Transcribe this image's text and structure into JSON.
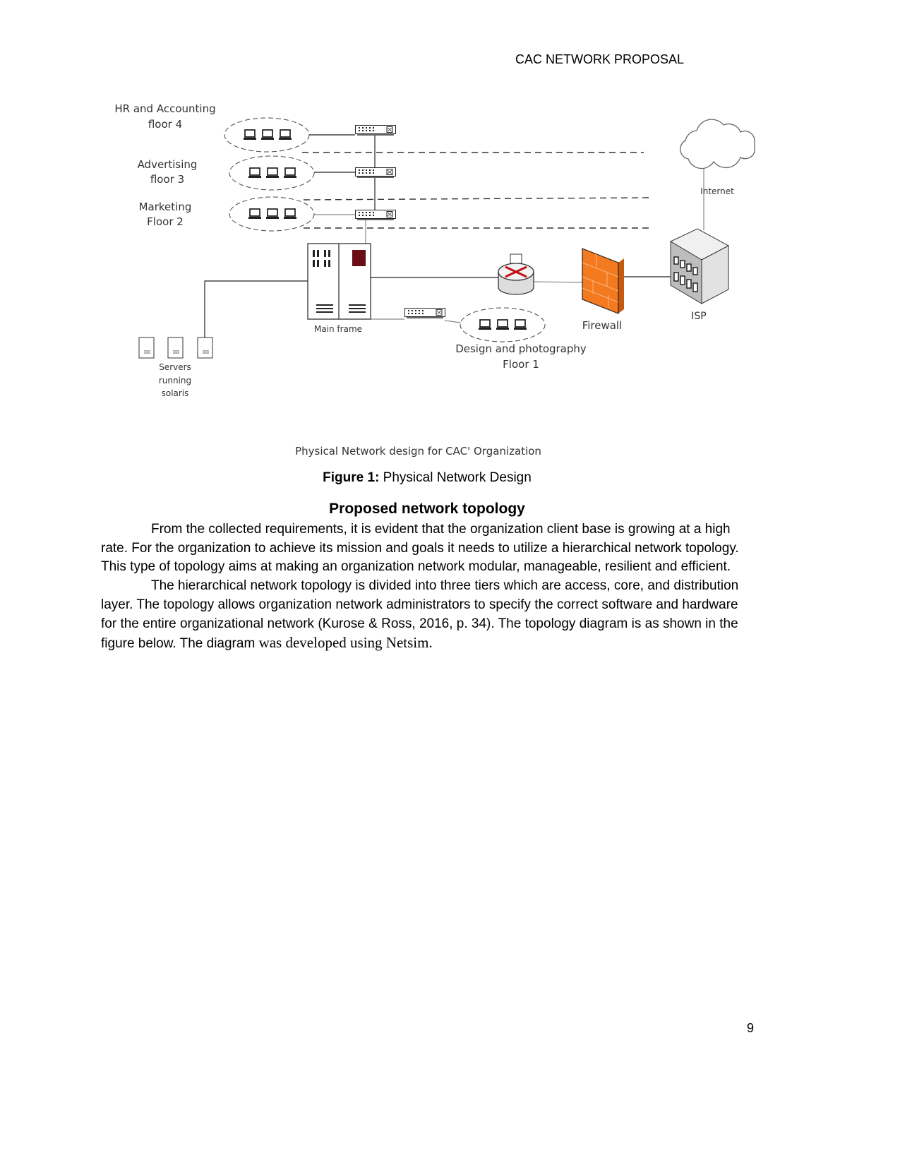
{
  "header": {
    "running_head": "CAC NETWORK PROPOSAL"
  },
  "diagram": {
    "labels": {
      "hr_line1": "HR and Accounting",
      "hr_line2": "floor 4",
      "adv_line1": "Advertising",
      "adv_line2": "floor 3",
      "mkt_line1": "Marketing",
      "mkt_line2": "Floor 2",
      "mainframe": "Main frame",
      "servers_line1": "Servers",
      "servers_line2": "running",
      "servers_line3": "solaris",
      "design_line1": "Design and photography",
      "design_line2": "Floor 1",
      "firewall": "Firewall",
      "isp": "ISP",
      "internet": "Internet"
    },
    "colors": {
      "firewall": "#f47a20",
      "router_arrows": "#c0101a",
      "mainframe_panel": "#6a0d14"
    },
    "caption": "Physical Network design for CAC' Organization"
  },
  "figure": {
    "label": "Figure 1:",
    "title": " Physical Network Design"
  },
  "section": {
    "heading": "Proposed network topology",
    "paragraphs": [
      "From the collected requirements, it is evident that the organization client base is growing at a high rate. For the organization to achieve its mission and goals it needs to utilize a hierarchical network topology. This type of topology aims at making an organization network modular, manageable, resilient and efficient.",
      "The hierarchical network topology is divided into three tiers which are access, core, and distribution layer. The topology allows organization network administrators to specify the correct software and hardware for the entire organizational network (Kurose & Ross, 2016, p. 34). The topology diagram is as shown in the figure below. The diagram "
    ],
    "paragraph2_tail": "was developed using Netsim."
  },
  "footer": {
    "page_number": "9"
  }
}
